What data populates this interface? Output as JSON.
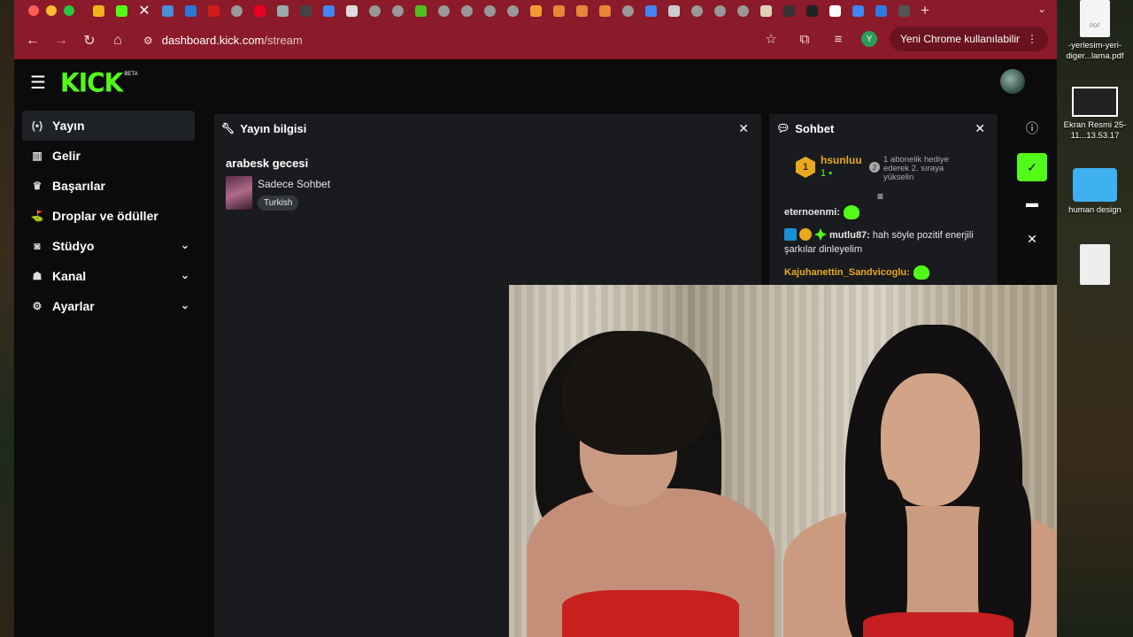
{
  "browser": {
    "url_host": "dashboard.kick.com",
    "url_path": "/stream",
    "update_label": "Yeni Chrome kullanılabilir",
    "profile_initial": "Y",
    "tab_icon_colors": [
      "#f0b21a",
      "#53fc18",
      "#4a90d9",
      "#2a78d6",
      "#d11a1a",
      "#999",
      "#e60023",
      "#9aa",
      "#444",
      "#4285f4",
      "#ddd",
      "#999",
      "#999",
      "#53c01e",
      "#999",
      "#999",
      "#999",
      "#999",
      "#f29a38",
      "#e8863a",
      "#e8863a",
      "#e8863a",
      "#999",
      "#4285f4",
      "#ccc",
      "#999",
      "#999",
      "#999",
      "#e0d2b8",
      "#333",
      "#222",
      "#fff",
      "#4285f4",
      "#2d7be5",
      "#555"
    ]
  },
  "kick": {
    "logo_text": "KICK",
    "logo_badge": "BETA",
    "brand_color": "#53fc18"
  },
  "sidebar": {
    "items": [
      {
        "label": "Yayın",
        "icon": "broadcast-icon",
        "active": true
      },
      {
        "label": "Gelir",
        "icon": "chart-icon"
      },
      {
        "label": "Başarılar",
        "icon": "trophy-icon"
      },
      {
        "label": "Droplar ve ödüller",
        "icon": "gift-icon"
      },
      {
        "label": "Stüdyo",
        "icon": "studio-icon",
        "expandable": true
      },
      {
        "label": "Kanal",
        "icon": "channel-icon",
        "expandable": true
      },
      {
        "label": "Ayarlar",
        "icon": "gear-icon",
        "expandable": true
      }
    ]
  },
  "stream_info": {
    "header": "Yayın bilgisi",
    "title": "arabesk gecesi",
    "category": "Sadece Sohbet",
    "language_tag": "Turkish"
  },
  "chat": {
    "header": "Sohbet",
    "gift": {
      "user": "hsunluu",
      "badge_level": "1",
      "count": "1",
      "rank": "2",
      "text": "1 abonelik hediye ederek 2. sıraya yükselin"
    },
    "messages": [
      {
        "user": "eternoenmi:",
        "text": "",
        "color": "#ffffff"
      },
      {
        "user": "mutlu87:",
        "text": "hah söyle pozitif enerjili şarkılar dinleyelim",
        "color": "#ffffff"
      },
      {
        "user": "Kajuhanettin_Sandvicoglu:",
        "text": "",
        "color": "#e8a91f"
      }
    ]
  },
  "desktop": {
    "files": [
      {
        "label": "-yerlesim-yeri-diger...lama.pdf",
        "type": "pdf"
      },
      {
        "label": "Ekran Resmi 25-11...13.53.17",
        "type": "screenshot"
      },
      {
        "label": "human design",
        "type": "folder"
      },
      {
        "label": "",
        "type": "document"
      }
    ]
  }
}
